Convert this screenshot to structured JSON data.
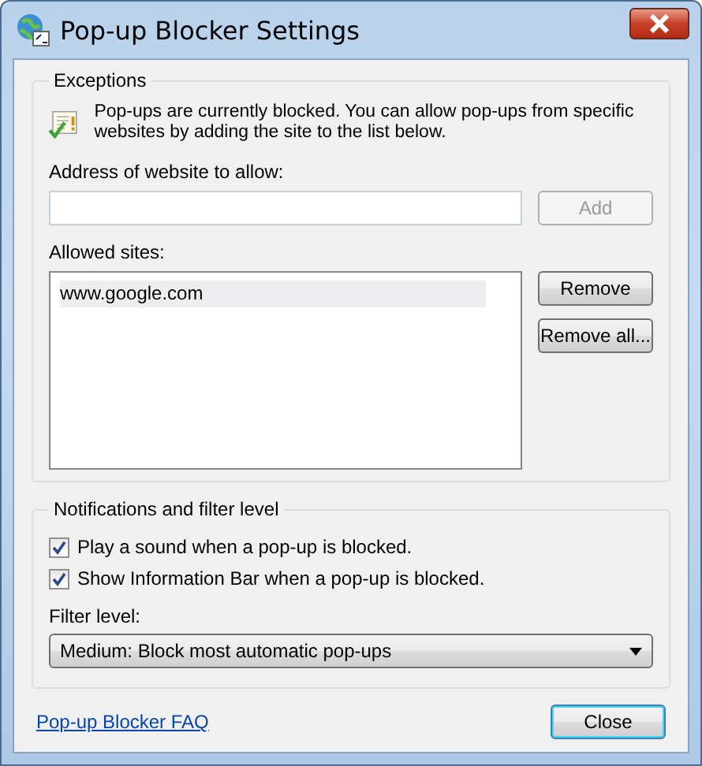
{
  "window": {
    "title": "Pop-up Blocker Settings"
  },
  "exceptions": {
    "legend": "Exceptions",
    "info": "Pop-ups are currently blocked.  You can allow pop-ups from specific websites by adding the site to the list below.",
    "address_label": "Address of website to allow:",
    "add_button": {
      "label": "Add",
      "disabled": true
    },
    "allowed_label": "Allowed sites:",
    "allowed_sites": [
      {
        "label": "www.google.com",
        "selected": true
      }
    ],
    "buttons": [
      "Remove",
      "Remove all..."
    ]
  },
  "notifications": {
    "legend": "Notifications and filter level",
    "checkboxes": [
      {
        "label": "Play a sound when a pop-up is blocked.",
        "checked": true
      },
      {
        "label": "Show Information Bar when a pop-up is blocked.",
        "checked": true
      }
    ],
    "filter_label": "Filter level:",
    "filter_value": "Medium: Block most automatic pop-ups"
  },
  "footer": {
    "link": "Pop-up Blocker FAQ",
    "close_button": "Close"
  }
}
